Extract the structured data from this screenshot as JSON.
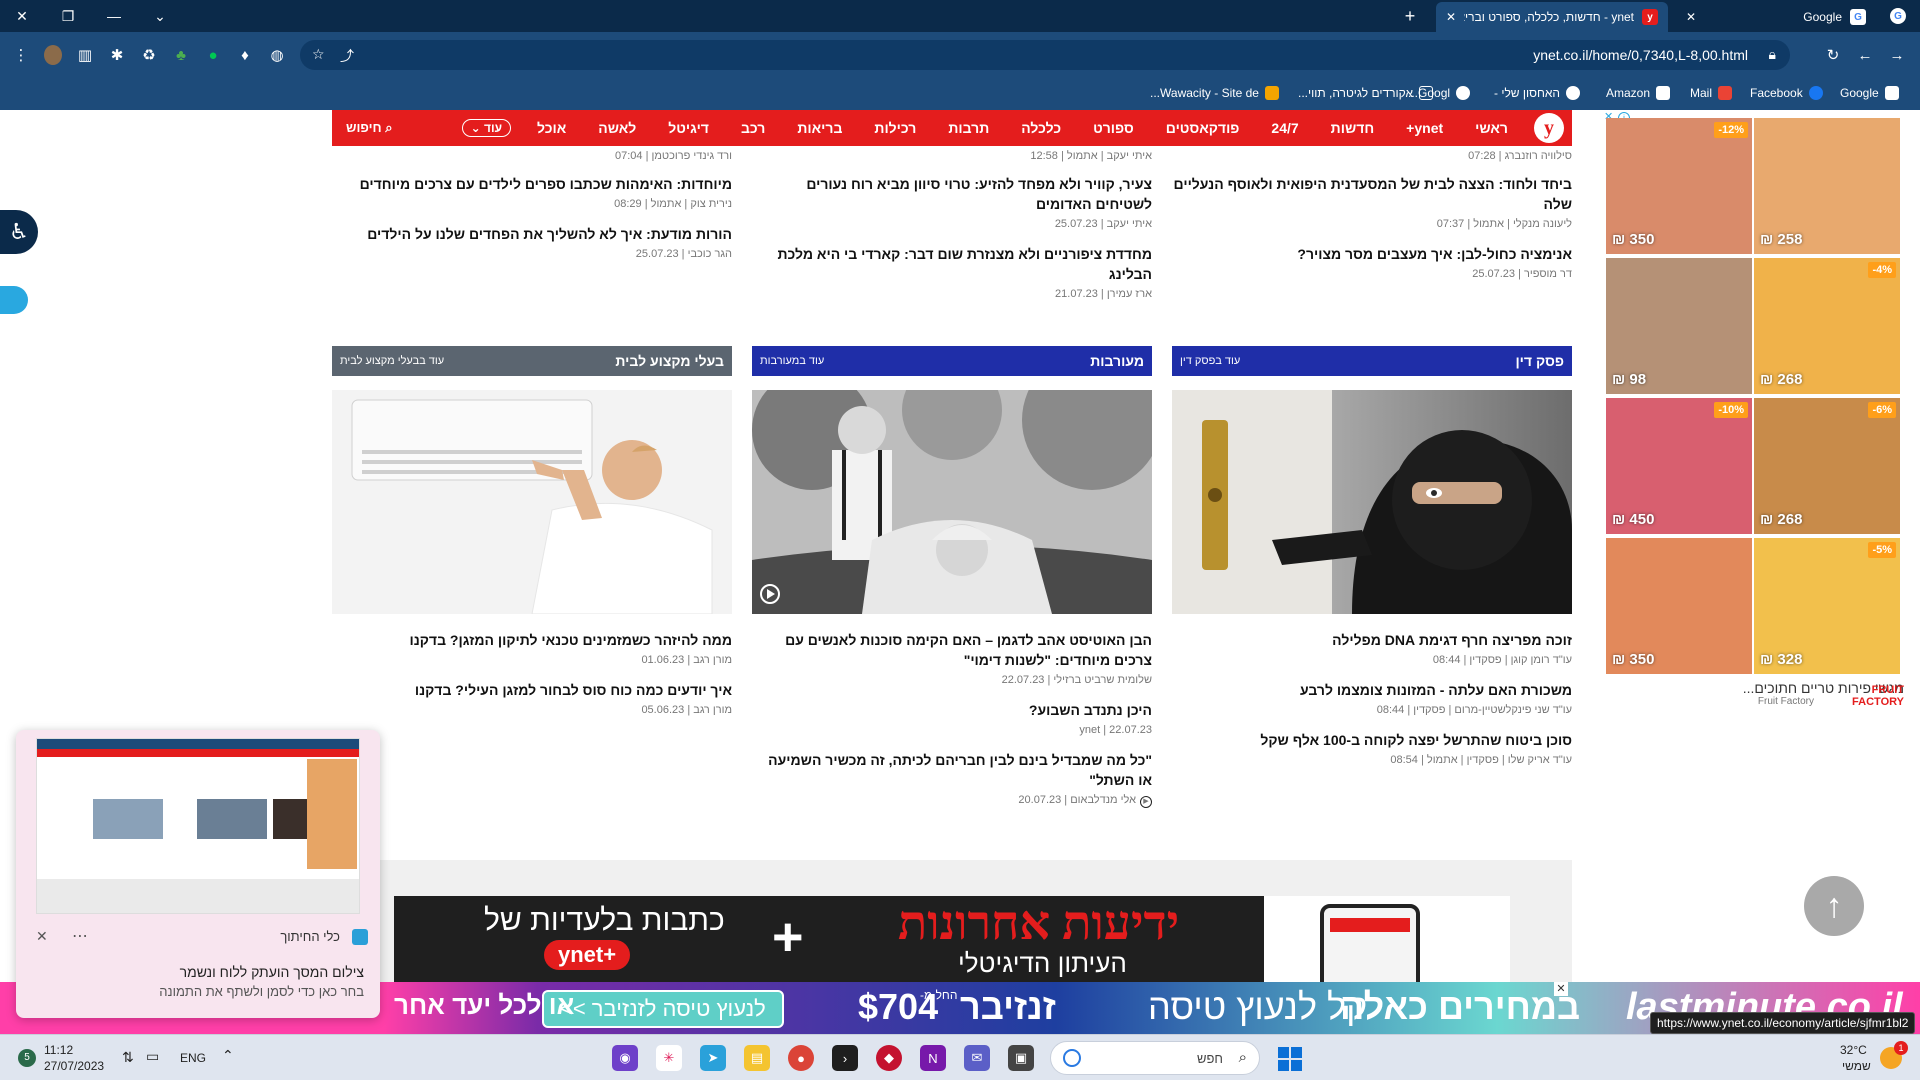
{
  "browser": {
    "tabs": [
      {
        "title": "Google",
        "active": false
      },
      {
        "title": "ynet - חדשות, כלכלה, ספורט ובריאות - דיווחים שוטפים מהארץ ומהעולם",
        "active": true
      }
    ],
    "url": "ynet.co.il/home/0,7340,L-8,00.html",
    "bookmarks": [
      "Google",
      "Facebook",
      "Mail",
      "Amazon",
      "האחסון שלי -",
      "Googl...",
      "אקורדים לגיטרה, תווי...",
      "Wawacity - Site de..."
    ]
  },
  "nav": {
    "logo": "y",
    "items": [
      "ראשי",
      "ynet+",
      "חדשות",
      "24/7",
      "פודקאסטים",
      "ספורט",
      "כלכלה",
      "תרבות",
      "רכילות",
      "בריאות",
      "רכב",
      "דיגיטל",
      "לאשה",
      "אוכל"
    ],
    "more": "עוד",
    "search": "חיפוש"
  },
  "top_stories": {
    "col_right": [
      {
        "meta": "סילוויה רוזנברג | 07:28",
        "headline": ""
      },
      {
        "headline": "ביחד ולחוד: הצצה לבית של המסעדנית היפואית ולאוסף הנעליים שלה",
        "meta": "ליעונה מנקלי | אתמול | 07:37"
      },
      {
        "headline": "אנימציה כחול-לבן: איך מעצבים מסר מצויר?",
        "meta": "דר מוספיר | 25.07.23"
      }
    ],
    "col_middle": [
      {
        "meta": "איתי יעקב | אתמול | 12:58",
        "headline": ""
      },
      {
        "headline": "צעיר, קוויר ולא מפחד להזיע: טרוי סיוון מביא רוח נעורים לשטיחים האדומים",
        "meta": "איתי יעקב | 25.07.23"
      },
      {
        "headline": "מחדדת ציפורניים ולא מצנזרת שום דבר: קארדי בי היא מלכת הבלינג",
        "meta": "ארז עמירן | 21.07.23"
      }
    ],
    "col_left": [
      {
        "meta": "ורד גינדי פרוכטמן | 07:04",
        "headline": ""
      },
      {
        "headline": "מיוחדות: האימהות שכתבו ספרים לילדים עם צרכים מיוחדים",
        "meta": "נירית צוק | אתמול | 08:29"
      },
      {
        "headline": "הורות מודעת: איך לא להשליך את הפחדים שלנו על הילדים",
        "meta": "הגר כוכבי | 25.07.23"
      }
    ]
  },
  "sections": [
    {
      "title": "פסק דין",
      "more": "עוד בפסק דין",
      "color": "#1f2ea8",
      "stories": [
        {
          "headline": "זוכה מפריצה חרף דגימת DNA מפלילה",
          "meta": "עו\"ד רומן קוגן | פסקדין | 08:44"
        },
        {
          "headline": "משכורת האם עלתה - המזונות צומצמו לרבע",
          "meta": "עו\"ד שני פינקלשטיין-מרום | פסקדין | 08:44"
        },
        {
          "headline": "סוכן ביטוח שהתרשל יפצה לקוחה ב-100 אלף שקל",
          "meta": "עו\"ד אריק שלו | פסקדין | אתמול | 08:54"
        }
      ]
    },
    {
      "title": "מעורבות",
      "more": "עוד במעורבות",
      "color": "#1f2ea8",
      "stories": [
        {
          "headline": "הבן האוטיסט אהב לדגמן – האם הקימה סוכנות לאנשים עם צרכים מיוחדים: \"לשנות דימוי\"",
          "meta": "שלומית שרביט ברזילי | 22.07.23"
        },
        {
          "headline": "היכן נתנדב השבוע?",
          "meta": "ynet | 22.07.23"
        },
        {
          "headline": "\"כל מה שמבדיל בינם לבין חבריהם לכיתה, זה מכשיר השמיעה או השתל\"",
          "meta": "אלי מנדלבאום | 20.07.23"
        }
      ]
    },
    {
      "title": "בעלי מקצוע לבית",
      "more": "עוד בבעלי מקצוע לבית",
      "color": "#5b6570",
      "stories": [
        {
          "headline": "ממה להיזהר כשמזמינים טכנאי לתיקון המזגן? בדקנו",
          "meta": "מורן רגב | 01.06.23"
        },
        {
          "headline": "איך יודעים כמה כוח סוס לבחור למזגן העילי? בדקנו",
          "meta": "מורן רגב | 05.06.23"
        }
      ]
    }
  ],
  "side_ad": {
    "products": [
      {
        "price": "₪ 258",
        "discount": ""
      },
      {
        "price": "₪ 350",
        "discount": "-12%"
      },
      {
        "price": "₪ 268",
        "discount": "-4%"
      },
      {
        "price": "₪ 98",
        "discount": ""
      },
      {
        "price": "₪ 268",
        "discount": "-6%"
      },
      {
        "price": "₪ 450",
        "discount": "-10%"
      },
      {
        "price": "₪ 328",
        "discount": "-5%"
      },
      {
        "price": "₪ 350",
        "discount": ""
      }
    ],
    "title": "מגשי פירות טריים חתוכים...",
    "brand": "Fruit Factory",
    "logo": "FRUIT FACTORY"
  },
  "banner": {
    "left_text": "כתבות בלעדיות של",
    "left_brand": "ynet+",
    "plus": "+",
    "right_title": "ידיעות אחרונות",
    "right_sub": "העיתון הדיגיטלי"
  },
  "bottom_ad": {
    "brand": "lastminute.co.il",
    "text1": "במחירים כאלה",
    "text2": "קל לנעוץ טיסה",
    "text3": "זנזיבר",
    "price_prefix": "החל מ-",
    "price": "$704",
    "cta": "לנעוץ טיסה לזנזיבר >>",
    "slogan": "או לכל יעד אחר"
  },
  "snip": {
    "title": "כלי החיתוך",
    "message": "צילום המסך הועתק ללוח ונשמר",
    "sub": "בחר כאן כדי לסמן ולשתף את התמונה"
  },
  "status_url": "https://www.ynet.co.il/economy/article/sjfmr1bl2",
  "taskbar": {
    "time": "11:12",
    "date": "27/07/2023",
    "lang": "ENG",
    "search_placeholder": "חפש",
    "weather_temp": "32°C",
    "weather_desc": "שמשי",
    "notif_count": "1",
    "badge": "5"
  }
}
